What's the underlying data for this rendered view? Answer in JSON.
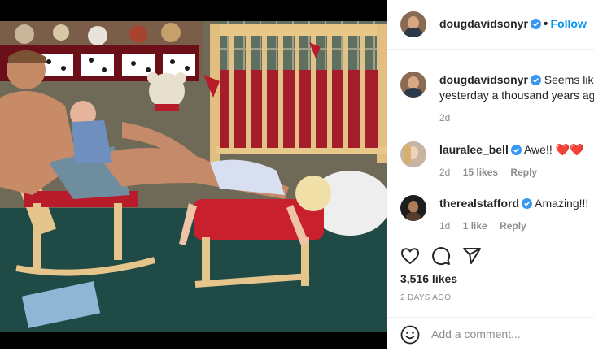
{
  "post": {
    "author": "dougdavidsonyr",
    "follow_label": "Follow",
    "caption": "Seems like yesterday a thousand years ago",
    "caption_line1": "Seems like",
    "caption_line2": "yesterday a thousand years ago",
    "caption_time": "2d"
  },
  "comments": [
    {
      "user": "lauralee_bell",
      "text": "Awe!!",
      "emoji": "❤️❤️",
      "time": "2d",
      "likes": "15 likes",
      "reply": "Reply"
    },
    {
      "user": "therealstafford",
      "text": "Amazing!!!",
      "time": "1d",
      "likes": "1 like",
      "reply": "Reply"
    }
  ],
  "footer": {
    "likes": "3,516 likes",
    "date": "2 DAYS AGO",
    "add_comment_placeholder": "Add a comment..."
  },
  "colors": {
    "link": "#0095f6",
    "text": "#262626",
    "muted": "#8e8e8e",
    "verified": "#3897f0",
    "heart": "#ed4956"
  },
  "icons": [
    "heart-icon",
    "comment-icon",
    "share-icon",
    "emoji-icon",
    "verified-badge-icon"
  ]
}
